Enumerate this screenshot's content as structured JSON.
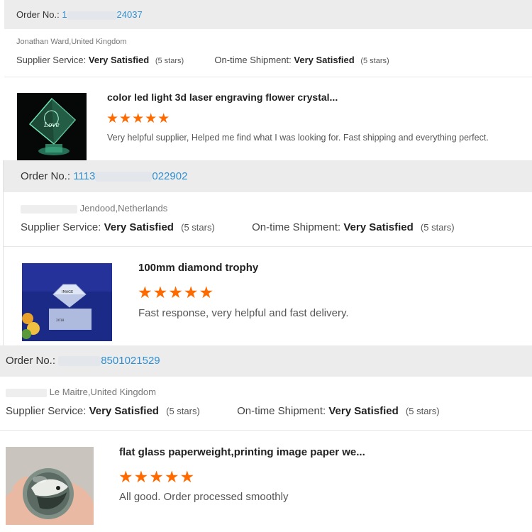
{
  "colors": {
    "accent_blue": "#2f8fd1",
    "star_orange": "#ff6a00",
    "bar_gray": "#ececec"
  },
  "reviews": [
    {
      "order_label": "Order No.:",
      "order_number_visible": "24037",
      "order_number_prefix": "1",
      "buyer_visible": "Jonathan Ward,United Kingdom",
      "supplier_service_label": "Supplier Service:",
      "supplier_service_value": "Very Satisfied",
      "supplier_service_note": "(5 stars)",
      "shipment_label": "On-time Shipment:",
      "shipment_value": "Very Satisfied",
      "shipment_note": "(5 stars)",
      "product_title": "color led light 3d laser engraving flower crystal...",
      "rating": 5,
      "stars": "★★★★★",
      "comment": "Very helpful supplier, Helped me find what I was looking for. Fast shipping and everything perfect.",
      "image_icon": "crystal-cube-photo"
    },
    {
      "order_label": "Order No.:",
      "order_number_prefix": "1113",
      "order_number_visible": "022902",
      "buyer_visible": "Jendood,Netherlands",
      "supplier_service_label": "Supplier Service:",
      "supplier_service_value": "Very Satisfied",
      "supplier_service_note": "(5 stars)",
      "shipment_label": "On-time Shipment:",
      "shipment_value": "Very Satisfied",
      "shipment_note": "(5 stars)",
      "product_title": "100mm diamond trophy",
      "rating": 5,
      "stars": "★★★★★",
      "comment": "Fast response, very helpful and fast delivery.",
      "image_icon": "diamond-trophy-photo"
    },
    {
      "order_label": "Order No.:",
      "order_number_prefix": "",
      "order_number_visible": "8501021529",
      "buyer_visible": "Le Maitre,United Kingdom",
      "supplier_service_label": "Supplier Service:",
      "supplier_service_value": "Very Satisfied",
      "supplier_service_note": "(5 stars)",
      "shipment_label": "On-time Shipment:",
      "shipment_value": "Very Satisfied",
      "shipment_note": "(5 stars)",
      "product_title": "flat glass paperweight,printing image paper we...",
      "rating": 5,
      "stars": "★★★★★",
      "comment": "All good. Order processed smoothly",
      "image_icon": "glass-paperweight-photo"
    }
  ]
}
